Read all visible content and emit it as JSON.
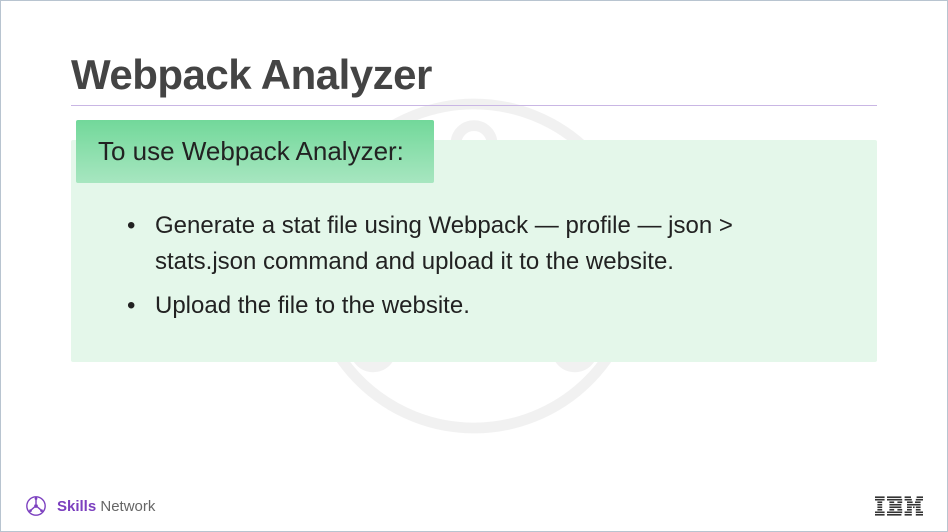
{
  "title": "Webpack Analyzer",
  "card": {
    "header": "To use Webpack Analyzer:",
    "items": [
      "Generate a stat file using Webpack — profile — json > stats.json command and upload it to the website.",
      "Upload the file to the website."
    ]
  },
  "footer": {
    "brand_bold": "Skills",
    "brand_rest": " Network",
    "right_logo": "IBM"
  }
}
